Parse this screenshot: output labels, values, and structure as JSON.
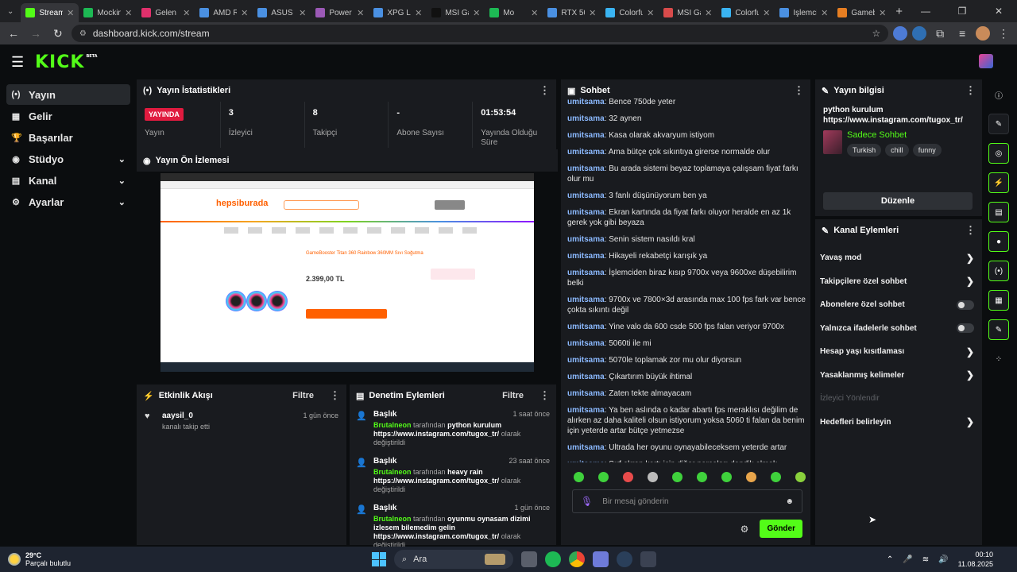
{
  "browser": {
    "tabs": [
      {
        "label": "Stream",
        "color": "#53fc18",
        "active": true
      },
      {
        "label": "Mocking",
        "color": "#1db954"
      },
      {
        "label": "Gelen K",
        "color": "#e1306c"
      },
      {
        "label": "AMD R",
        "color": "#4a90e2"
      },
      {
        "label": "ASUS R",
        "color": "#4a90e2"
      },
      {
        "label": "Power",
        "color": "#9b59b6"
      },
      {
        "label": "XPG La",
        "color": "#4a90e2"
      },
      {
        "label": "MSI Ga",
        "color": "#111111"
      },
      {
        "label": "Mo",
        "color": "#1db954"
      },
      {
        "label": "RTX 50",
        "color": "#4a90e2"
      },
      {
        "label": "Colorfu",
        "color": "#3ab4f2"
      },
      {
        "label": "MSI Ga",
        "color": "#d84b4b"
      },
      {
        "label": "Colorfu",
        "color": "#3ab4f2"
      },
      {
        "label": "İşlemci",
        "color": "#4a90e2"
      },
      {
        "label": "Gameb",
        "color": "#e67e22"
      }
    ],
    "url": "dashboard.kick.com/stream"
  },
  "nav": {
    "logo": "KICK",
    "logo_sup": "BETA",
    "items": [
      {
        "label": "Yayın",
        "icon": "(•)"
      },
      {
        "label": "Gelir",
        "icon": "▦"
      },
      {
        "label": "Başarılar",
        "icon": "🏆"
      },
      {
        "label": "Stüdyo",
        "icon": "◉"
      },
      {
        "label": "Kanal",
        "icon": "▤"
      },
      {
        "label": "Ayarlar",
        "icon": "⚙"
      }
    ]
  },
  "stats_panel": {
    "title": "Yayın İstatistikleri",
    "live_badge": "YAYINDA",
    "stats": [
      {
        "value": "",
        "label": "Yayın"
      },
      {
        "value": "3",
        "label": "İzleyici"
      },
      {
        "value": "8",
        "label": "Takipçi"
      },
      {
        "value": "-",
        "label": "Abone Sayısı"
      },
      {
        "value": "01:53:54",
        "label": "Yayında Olduğu Süre"
      }
    ]
  },
  "preview_panel": {
    "title": "Yayın Ön İzlemesi",
    "brand": "hepsiburada",
    "product": "GameBooster Titan 360 Rainbow 360MM Sıvı Soğutma",
    "price": "2.399,00 TL"
  },
  "activity_panel": {
    "title": "Etkinlik Akışı",
    "filter": "Filtre",
    "items": [
      {
        "name": "aaysil_0",
        "sub": "kanalı takip etti",
        "time": "1 gün önce"
      }
    ]
  },
  "mod_panel": {
    "title": "Denetim Eylemleri",
    "filter": "Filtre",
    "items": [
      {
        "head": "Başlık",
        "time": "1 saat önce",
        "actor": "Brutalneon",
        "by": "tarafından",
        "value": "python kurulum https://www.instagram.com/tugox_tr/",
        "suffix": "olarak değiştirildi"
      },
      {
        "head": "Başlık",
        "time": "23 saat önce",
        "actor": "Brutalneon",
        "by": "tarafından",
        "value": "heavy rain https://www.instagram.com/tugox_tr/",
        "suffix": "olarak değiştirildi"
      },
      {
        "head": "Başlık",
        "time": "1 gün önce",
        "actor": "Brutalneon",
        "by": "tarafından",
        "value": "oyunmu oynasam dizimi izlesem bilemedim gelin https://www.instagram.com/tugox_tr/",
        "suffix": "olarak değiştirildi"
      }
    ]
  },
  "chat": {
    "title": "Sohbet",
    "user": "umitsama",
    "messages": [
      "Bence 750de yeter",
      "32 aynen",
      "Kasa olarak akvaryum istiyom",
      "Ama bütçe çok sıkıntıya girerse normalde olur",
      "Bu arada sistemi beyaz toplamaya çalışsam fiyat farkı olur mu",
      "3 fanlı düşünüyorum ben ya",
      "Ekran kartında da fiyat farkı oluyor heralde en az 1k gerek yok gibi beyaza",
      "Senin sistem nasıldı kral",
      "Hikayeli rekabetçi karışık ya",
      "İşlemciden biraz kısıp 9700x veya 9600xe düşebilirim belki",
      "9700x ve 7800×3d arasında max 100 fps fark var bence çokta sıkıntı değil",
      "Yine valo da 600 csde 500 fps falan veriyor 9700x",
      "5060ti ile mi",
      "5070le toplamak zor mu olur diyorsun",
      "Çıkartırım büyük ihtimal",
      "Zaten tekte almayacam",
      "Ya ben aslında o kadar abartı fps meraklısı değilim de alırken az daha kaliteli olsun istiyorum yoksa 5060 ti falan da benim için yeterde artar bütçe yetmezse",
      "Ultrada her oyunu oynayabileceksem yeterde artar",
      "Sırf ekran kartı için diğer parçaları dandik almak istemiyorum"
    ],
    "placeholder": "Bir mesaj gönderin",
    "send": "Gönder"
  },
  "info_panel": {
    "title": "Yayın bilgisi",
    "stream_title": "python kurulum https://www.instagram.com/tugox_tr/",
    "category": "Sadece Sohbet",
    "tags": [
      "Turkish",
      "chill",
      "funny"
    ],
    "edit": "Düzenle"
  },
  "actions_panel": {
    "title": "Kanal Eylemleri",
    "items": [
      {
        "label": "Yavaş mod",
        "kind": "chevron"
      },
      {
        "label": "Takipçilere özel sohbet",
        "kind": "chevron"
      },
      {
        "label": "Abonelere özel sohbet",
        "kind": "toggle"
      },
      {
        "label": "Yalnızca ifadelerle sohbet",
        "kind": "toggle"
      },
      {
        "label": "Hesap yaşı kısıtlaması",
        "kind": "chevron"
      },
      {
        "label": "Yasaklanmış kelimeler",
        "kind": "chevron"
      },
      {
        "label": "İzleyici Yönlendir",
        "kind": "disabled"
      },
      {
        "label": "Hedefleri belirleyin",
        "kind": "chevron"
      }
    ]
  },
  "taskbar": {
    "temp": "29°C",
    "weather": "Parçalı bulutlu",
    "search": "Ara",
    "time": "00:10",
    "date": "11.08.2025"
  }
}
